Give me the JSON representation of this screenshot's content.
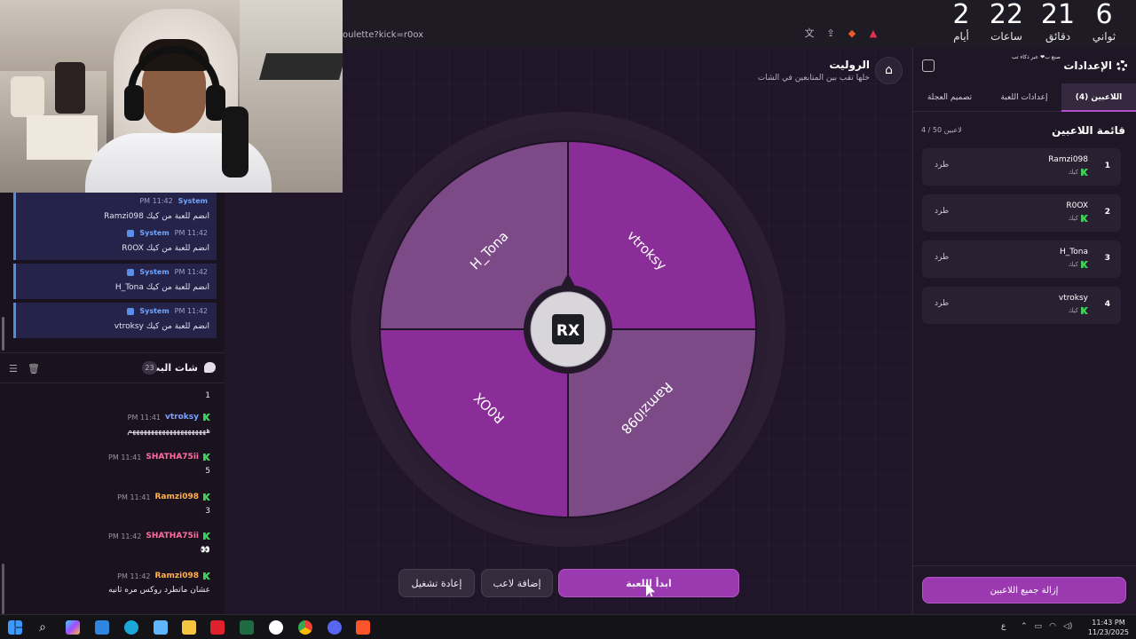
{
  "browser": {
    "url": "oulette?kick=r0ox"
  },
  "countdown": {
    "days_value": "2",
    "days_label": "أيام",
    "hours_value": "22",
    "hours_label": "ساعات",
    "minutes_value": "21",
    "minutes_label": "دقائق",
    "seconds_value": "6",
    "seconds_label": "ثواني"
  },
  "system_messages": [
    {
      "sender": "System",
      "time": "PM 11:42",
      "text": "Ramzi098 انضم للعبة من كيك"
    },
    {
      "sender": "System",
      "time": "PM 11:42",
      "text": "R0OX انضم للعبة من كيك"
    },
    {
      "sender": "System",
      "time": "PM 11:42",
      "text": "H_Tona انضم للعبة من كيك"
    },
    {
      "sender": "System",
      "time": "PM 11:42",
      "text": "vtroksy انضم للعبة من كيك"
    }
  ],
  "chat": {
    "title": "شات البث",
    "count": "23",
    "messages": [
      {
        "user": "",
        "time": "",
        "text": "1",
        "color": "#ffffff"
      },
      {
        "user": "vtroksy",
        "time": "PM 11:41",
        "text": "هههههههههههههههههههههم",
        "color": "#7aa2ff"
      },
      {
        "user": "SHATHA75ii",
        "time": "PM 11:41",
        "text": "5",
        "color": "#ff6fa1"
      },
      {
        "user": "Ramzi098",
        "time": "PM 11:41",
        "text": "3",
        "color": "#ffb14a"
      },
      {
        "user": "SHATHA75ii",
        "time": "PM 11:42",
        "text": "👀",
        "color": "#ff6fa1"
      },
      {
        "user": "Ramzi098",
        "time": "PM 11:42",
        "text": "عشان ماتطرد روكس مره ثانيه",
        "color": "#ffb14a"
      }
    ]
  },
  "page": {
    "title": "الروليت",
    "subtitle": "خلها تقب بين المتابعين في الشات"
  },
  "wheel": {
    "center_logo": "RX",
    "segments": [
      {
        "name": "vtroksy",
        "color": "#8a2d98"
      },
      {
        "name": "Ramzi098",
        "color": "#7b4a87"
      },
      {
        "name": "R0OX",
        "color": "#8a2d98"
      },
      {
        "name": "H_Tona",
        "color": "#7b4a87"
      }
    ]
  },
  "buttons": {
    "restart": "إعادة تشغيل",
    "add_player": "إضافة لاعب",
    "start_game": "ابدأ اللعبة",
    "remove_all": "إزالة جميع اللاعبين"
  },
  "sidebar": {
    "title": "الإعدادات",
    "note": "صنع ب❤ عبر ذكاء تب",
    "tabs": [
      {
        "label": "اللاعبين (4)",
        "active": true
      },
      {
        "label": "إعدادات اللعبة",
        "active": false
      },
      {
        "label": "تصميم العجلة",
        "active": false
      }
    ],
    "list_title": "قائمة اللاعبين",
    "list_count": "4 / 50 لاعبين",
    "kick_label": "طرد",
    "platform_label": "كيك",
    "players": [
      {
        "num": "1",
        "name": "Ramzi098"
      },
      {
        "num": "2",
        "name": "R0OX"
      },
      {
        "num": "3",
        "name": "H_Tona"
      },
      {
        "num": "4",
        "name": "vtroksy"
      }
    ]
  },
  "taskbar": {
    "time": "11:43 PM",
    "date": "11/23/2025",
    "lang": "ع"
  },
  "colors": {
    "accent": "#9b3ab0",
    "background": "#211629",
    "kick_green": "#3fd25a"
  }
}
